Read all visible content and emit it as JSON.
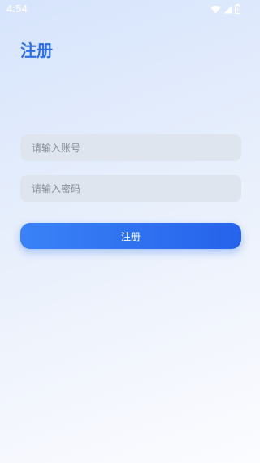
{
  "status_bar": {
    "time": "4:54",
    "icons": [
      "wifi-icon",
      "cellular-signal-icon",
      "battery-icon"
    ]
  },
  "page": {
    "title": "注册"
  },
  "form": {
    "account_placeholder": "请输入账号",
    "account_value": "",
    "password_placeholder": "请输入密码",
    "password_value": "",
    "submit_label": "注册"
  },
  "colors": {
    "accent": "#2f6fe0",
    "button_start": "#3a82f6",
    "button_end": "#2563eb",
    "input_bg": "#dfe5ef",
    "placeholder": "#8a9099"
  }
}
